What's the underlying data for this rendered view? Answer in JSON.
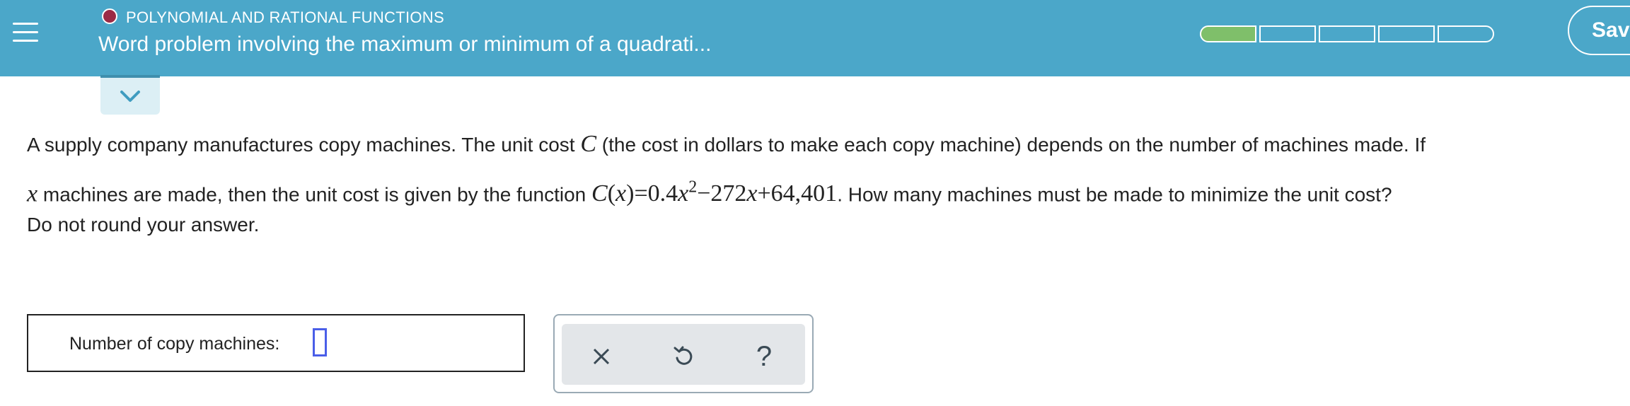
{
  "header": {
    "topic": "POLYNOMIAL AND RATIONAL FUNCTIONS",
    "title": "Word problem involving the maximum or minimum of a quadrati...",
    "save_label": "Save",
    "progress": {
      "segments": 5,
      "completed": 1
    },
    "colors": {
      "bar": "#4ba7c9",
      "topic_dot": "#9b2a45",
      "progress_fill": "#7fbf6a"
    }
  },
  "question": {
    "p1": "A supply company manufactures copy machines. The unit cost ",
    "var_C": "C",
    "p2": " (the cost in dollars to make each copy machine) depends on the number of machines made. If",
    "var_x": "x",
    "p3": " machines are made, then the unit cost is given by the function ",
    "fn_name": "C",
    "fn_lparen": "(",
    "fn_arg": "x",
    "fn_rparen": ")",
    "fn_eq": "=0.4",
    "fn_x1": "x",
    "fn_exp": "2",
    "fn_minus": "−272",
    "fn_x2": "x",
    "fn_plus": "+64,401",
    "p4": ". How many machines must be made to minimize the unit cost?",
    "note": "Do not round your answer."
  },
  "answer": {
    "label": "Number of copy machines:",
    "value": ""
  },
  "tools": {
    "clear_icon": "close-icon",
    "undo_icon": "undo-icon",
    "help_icon": "help-icon",
    "help_glyph": "?"
  }
}
